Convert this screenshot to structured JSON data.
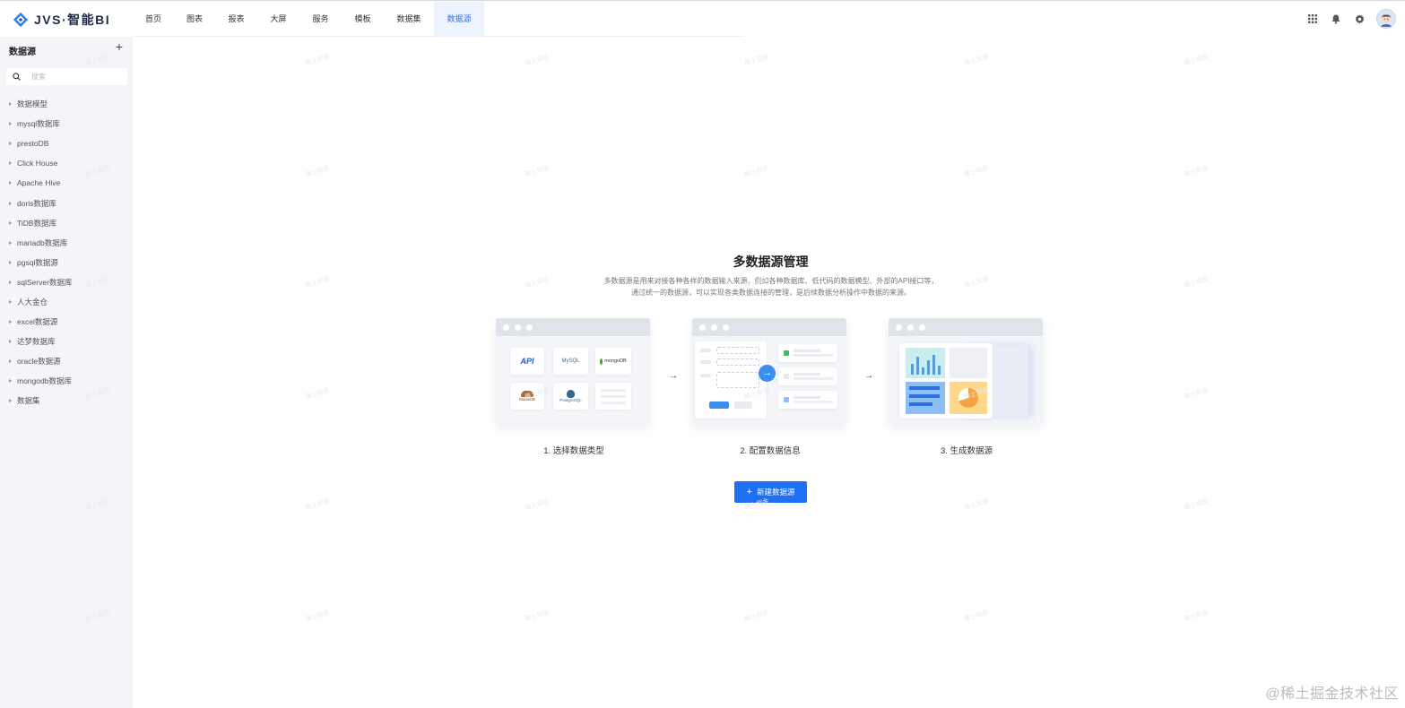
{
  "app": {
    "logo_text": "JVS·智能BI"
  },
  "nav": {
    "items": [
      {
        "label": "首页",
        "width": 46
      },
      {
        "label": "图表",
        "width": 46
      },
      {
        "label": "报表",
        "width": 47
      },
      {
        "label": "大屏",
        "width": 47
      },
      {
        "label": "服务",
        "width": 47
      },
      {
        "label": "模板",
        "width": 47
      },
      {
        "label": "数据集",
        "width": 56
      },
      {
        "label": "数据源",
        "width": 56
      }
    ],
    "active": "数据源"
  },
  "header_icons": [
    "apps-grid-icon",
    "bell-icon",
    "settings-gear-icon",
    "user-avatar"
  ],
  "sidebar": {
    "title": "数据源",
    "add_label": "+",
    "search_placeholder": "搜索",
    "items": [
      "数据模型",
      "mysql数据库",
      "prestoDB",
      "Click House",
      "Apache Hive",
      "doris数据库",
      "TiDB数据库",
      "mariadb数据库",
      "pgsql数据源",
      "sqlServer数据库",
      "人大金仓",
      "excel数据源",
      "达梦数据库",
      "oracle数据源",
      "mongodb数据库",
      "数据集"
    ]
  },
  "main": {
    "title": "多数据源管理",
    "description": "多数据源是用来对接各种各样的数据输入来源。例如各种数据库、低代码的数据模型、外部的API接口等，通过统一的数据源，可以实现各类数据连接的管理，是后续数据分析操作中数据的来源。",
    "steps": [
      {
        "label": "1. 选择数据类型"
      },
      {
        "label": "2. 配置数据信息"
      },
      {
        "label": "3. 生成数据源"
      }
    ],
    "step_arrow": "→",
    "tiles": {
      "api": "API",
      "mysql": "MySQL",
      "mongodb": "mongoDB",
      "mariadb": "MariaDB",
      "postgresql": "PostgreSQL"
    },
    "new_button": {
      "icon": "+",
      "label": "新建数据源"
    }
  },
  "watermark_text": "稀土掘金",
  "corner_watermark": "@稀土掘金技术社区",
  "colors": {
    "accent": "#1f6ff2",
    "sidebar_bg": "#f3f5f8",
    "active_nav_bg": "#eef4ff"
  }
}
